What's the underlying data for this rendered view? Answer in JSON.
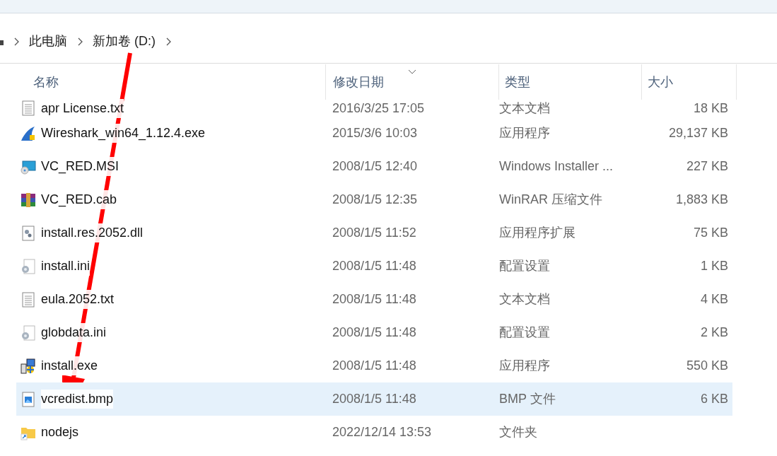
{
  "breadcrumb": [
    "此电脑",
    "新加卷 (D:)"
  ],
  "columns": [
    "名称",
    "修改日期",
    "类型",
    "大小"
  ],
  "rows": [
    {
      "kind": "text",
      "name": "apr License.txt",
      "date": "2016/3/25 17:05",
      "type": "文本文档",
      "size": "18 KB",
      "selected": false
    },
    {
      "kind": "shark",
      "name": "Wireshark_win64_1.12.4.exe",
      "date": "2015/3/6 10:03",
      "type": "应用程序",
      "size": "29,137 KB",
      "selected": false
    },
    {
      "kind": "installer",
      "name": "VC_RED.MSI",
      "date": "2008/1/5 12:40",
      "type": "Windows Installer ...",
      "size": "227 KB",
      "selected": false
    },
    {
      "kind": "archive",
      "name": "VC_RED.cab",
      "date": "2008/1/5 12:35",
      "type": "WinRAR 压缩文件",
      "size": "1,883 KB",
      "selected": false
    },
    {
      "kind": "library",
      "name": "install.res.2052.dll",
      "date": "2008/1/5 11:52",
      "type": "应用程序扩展",
      "size": "75 KB",
      "selected": false
    },
    {
      "kind": "settings",
      "name": "install.ini",
      "date": "2008/1/5 11:48",
      "type": "配置设置",
      "size": "1 KB",
      "selected": false
    },
    {
      "kind": "text",
      "name": "eula.2052.txt",
      "date": "2008/1/5 11:48",
      "type": "文本文档",
      "size": "4 KB",
      "selected": false
    },
    {
      "kind": "settings",
      "name": "globdata.ini",
      "date": "2008/1/5 11:48",
      "type": "配置设置",
      "size": "2 KB",
      "selected": false
    },
    {
      "kind": "setup",
      "name": "install.exe",
      "date": "2008/1/5 11:48",
      "type": "应用程序",
      "size": "550 KB",
      "selected": false
    },
    {
      "kind": "image",
      "name": "vcredist.bmp",
      "date": "2008/1/5 11:48",
      "type": "BMP 文件",
      "size": "6 KB",
      "selected": true
    },
    {
      "kind": "folder",
      "name": "nodejs",
      "date": "2022/12/14 13:53",
      "type": "文件夹",
      "selected": false
    }
  ]
}
